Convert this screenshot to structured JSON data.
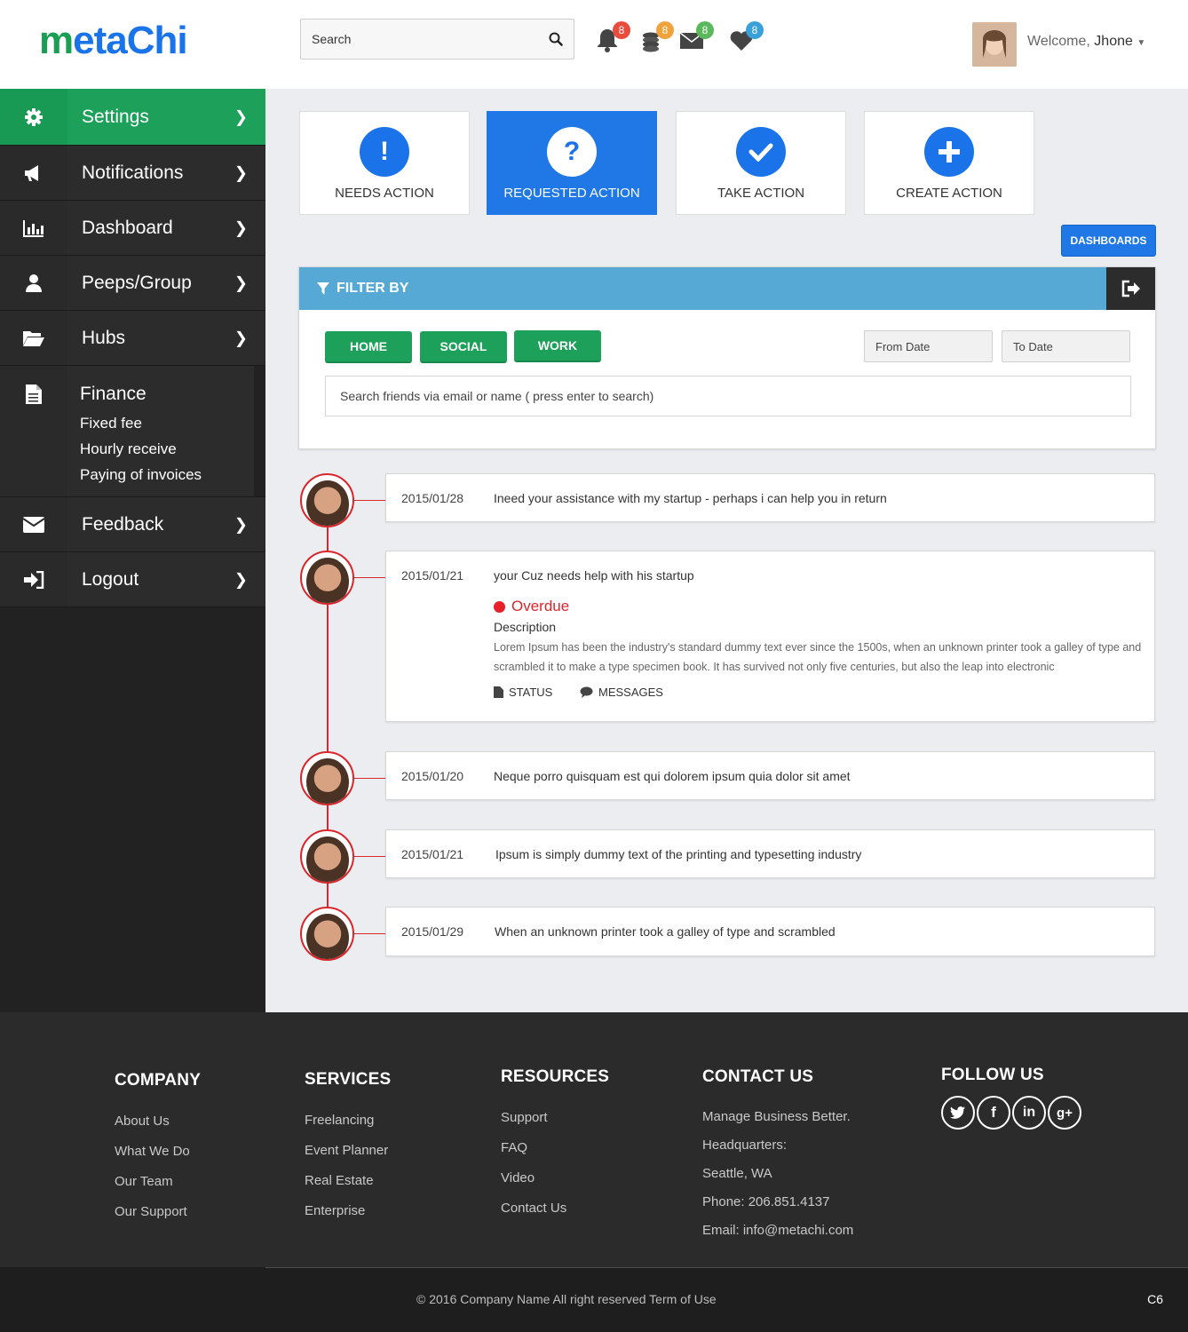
{
  "header": {
    "logo_prefix": "m",
    "logo_rest": "etaChi",
    "search_placeholder": "Search",
    "badges": {
      "notifications": "8",
      "coins": "8",
      "messages": "8",
      "favorites": "8"
    },
    "welcome_label": "Welcome,",
    "user_name": "Jhone"
  },
  "sidebar": {
    "items": [
      {
        "label": "Settings",
        "icon": "gear-icon",
        "active": true
      },
      {
        "label": "Notifications",
        "icon": "megaphone-icon"
      },
      {
        "label": "Dashboard",
        "icon": "bar-chart-icon"
      },
      {
        "label": "Peeps/Group",
        "icon": "user-icon"
      },
      {
        "label": "Hubs",
        "icon": "folder-open-icon"
      }
    ],
    "finance": {
      "label": "Finance",
      "subs": [
        "Fixed fee",
        "Hourly receive",
        "Paying of invoices"
      ]
    },
    "bottom_items": [
      {
        "label": "Feedback",
        "icon": "envelope-icon"
      },
      {
        "label": "Logout",
        "icon": "sign-in-icon"
      }
    ]
  },
  "actions": [
    "NEEDS ACTION",
    "REQUESTED ACTION",
    "TAKE ACTION",
    "CREATE ACTION"
  ],
  "dashboards_label": "DASHBOARDS",
  "filter": {
    "title": "FILTER BY",
    "buttons": [
      "HOME",
      "SOCIAL",
      "WORK"
    ],
    "from_placeholder": "From Date",
    "to_placeholder": "To Date",
    "search_placeholder": "Search friends via email or name ( press enter to search)"
  },
  "timeline": [
    {
      "date": "2015/01/28",
      "text": "Ineed your assistance with my startup - perhaps i can help you in return"
    },
    {
      "date": "2015/01/21",
      "text": "your Cuz needs help with his startup",
      "status": "Overdue",
      "desc_title": "Description",
      "desc": "Lorem Ipsum has been the industry's standard dummy text ever since the 1500s, when an unknown printer took a galley of type and scrambled it to make a type specimen book. It has survived not only five centuries, but also the leap into electronic",
      "status_label": "STATUS",
      "messages_label": "MESSAGES"
    },
    {
      "date": "2015/01/20",
      "text": "Neque porro quisquam est qui dolorem ipsum quia dolor sit amet"
    },
    {
      "date": "2015/01/21",
      "text": "Ipsum is simply dummy text of the printing and typesetting industry"
    },
    {
      "date": "2015/01/29",
      "text": "When an unknown printer took a galley of type and scrambled"
    }
  ],
  "footer": {
    "company": {
      "title": "COMPANY",
      "links": [
        "About Us",
        "What We Do",
        "Our Team",
        "Our Support"
      ]
    },
    "services": {
      "title": "SERVICES",
      "links": [
        "Freelancing",
        "Event Planner",
        "Real Estate",
        "Enterprise"
      ]
    },
    "resources": {
      "title": "RESOURCES",
      "links": [
        "Support",
        "FAQ",
        "Video",
        "Contact Us"
      ]
    },
    "contact": {
      "title": "CONTACT US",
      "lines": [
        "Manage Business Better.",
        "Headquarters:",
        "Seattle, WA",
        "Phone: 206.851.4137",
        "Email: info@metachi.com"
      ]
    },
    "follow": {
      "title": "FOLLOW US"
    },
    "copyright": "© 2016 Company Name  All right reserved  Term of Use",
    "page_code": "C6"
  },
  "colors": {
    "green": "#1ca05a",
    "blue": "#1f78e6",
    "red": "#d9262b",
    "filter_bar": "#56a9d4"
  }
}
